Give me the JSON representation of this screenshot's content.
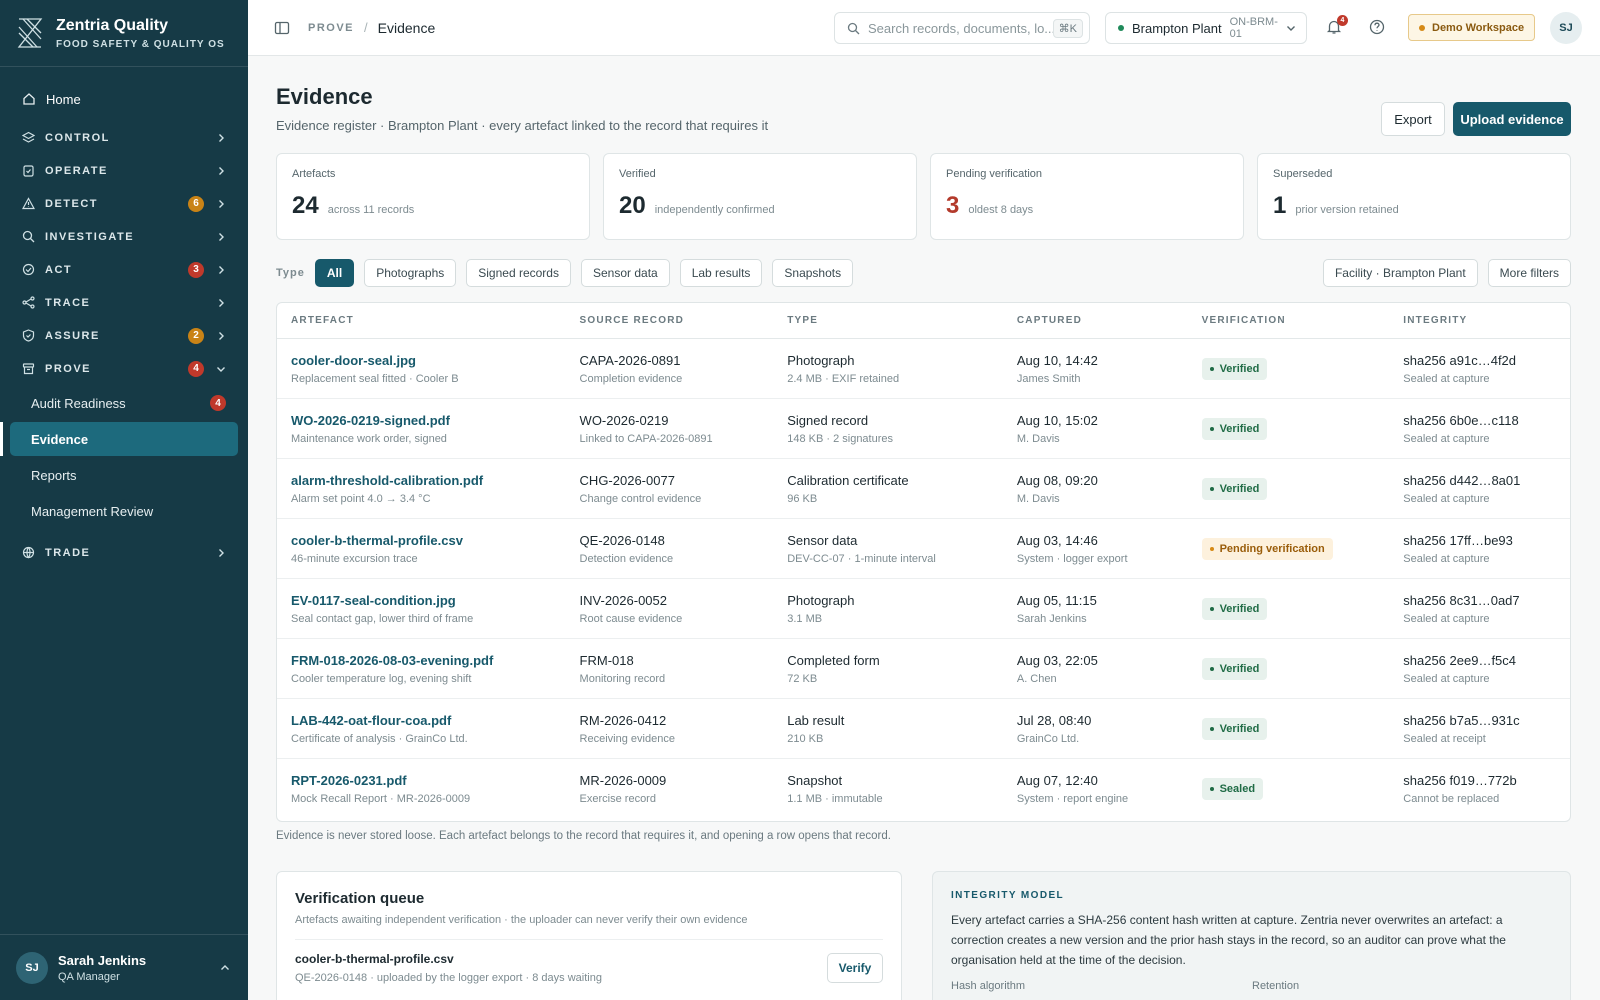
{
  "brand": {
    "title": "Zentria Quality",
    "subtitle": "FOOD SAFETY & QUALITY OS"
  },
  "nav": {
    "home": "Home",
    "sections": [
      {
        "label": "CONTROL",
        "icon": "layers-icon",
        "badge": ""
      },
      {
        "label": "OPERATE",
        "icon": "clipboard-icon",
        "badge": ""
      },
      {
        "label": "DETECT",
        "icon": "warning-icon",
        "badge": "6",
        "badge_color": "#c98316"
      },
      {
        "label": "INVESTIGATE",
        "icon": "search-icon",
        "badge": ""
      },
      {
        "label": "ACT",
        "icon": "check-circle-icon",
        "badge": "3",
        "badge_color": "#c0392b"
      },
      {
        "label": "TRACE",
        "icon": "share-icon",
        "badge": ""
      },
      {
        "label": "ASSURE",
        "icon": "shield-icon",
        "badge": "2",
        "badge_color": "#c98316"
      },
      {
        "label": "PROVE",
        "icon": "archive-icon",
        "badge": "4",
        "badge_color": "#c0392b"
      },
      {
        "label": "TRADE",
        "icon": "globe-icon",
        "badge": ""
      }
    ],
    "prove_items": [
      {
        "label": "Audit Readiness",
        "badge": "4"
      },
      {
        "label": "Evidence",
        "badge": ""
      },
      {
        "label": "Reports",
        "badge": ""
      },
      {
        "label": "Management Review",
        "badge": ""
      }
    ]
  },
  "user": {
    "initials": "SJ",
    "name": "Sarah Jenkins",
    "role": "QA Manager"
  },
  "topbar": {
    "breadcrumb_root": "PROVE",
    "breadcrumb_sep": "/",
    "breadcrumb_current": "Evidence",
    "search_placeholder": "Search records, documents, lo...",
    "search_shortcut": "⌘K",
    "plant_name": "Brampton Plant",
    "plant_code": "ON-BRM-01",
    "notification_count": "4",
    "workspace_label": "Demo Workspace",
    "avatar_initials": "SJ"
  },
  "page": {
    "title": "Evidence",
    "subtitle": "Evidence register · Brampton Plant · every artefact linked to the record that requires it",
    "export_label": "Export",
    "upload_label": "Upload evidence"
  },
  "stats": [
    {
      "label": "Artefacts",
      "value": "24",
      "note": "across 11 records"
    },
    {
      "label": "Verified",
      "value": "20",
      "note": "independently confirmed"
    },
    {
      "label": "Pending verification",
      "value": "3",
      "note": "oldest 8 days"
    },
    {
      "label": "Superseded",
      "value": "1",
      "note": "prior version retained"
    }
  ],
  "filters": {
    "label": "Type",
    "chips": [
      "All",
      "Photographs",
      "Signed records",
      "Sensor data",
      "Lab results",
      "Snapshots"
    ],
    "facility": "Facility · Brampton Plant",
    "more": "More filters"
  },
  "table": {
    "headers": [
      "ARTEFACT",
      "SOURCE RECORD",
      "TYPE",
      "CAPTURED",
      "VERIFICATION",
      "INTEGRITY"
    ],
    "rows": [
      {
        "name": "cooler-door-seal.jpg",
        "desc": "Replacement seal fitted · Cooler B",
        "record": "CAPA-2026-0891",
        "record_note": "Completion evidence",
        "type": "Photograph",
        "type_note": "2.4 MB · EXIF retained",
        "captured": "Aug 10, 14:42",
        "captured_by": "James Smith",
        "status": "Verified",
        "status_kind": "verified",
        "hash": "sha256 a91c…4f2d",
        "hash_note": "Sealed at capture"
      },
      {
        "name": "WO-2026-0219-signed.pdf",
        "desc": "Maintenance work order, signed",
        "record": "WO-2026-0219",
        "record_note": "Linked to CAPA-2026-0891",
        "type": "Signed record",
        "type_note": "148 KB · 2 signatures",
        "captured": "Aug 10, 15:02",
        "captured_by": "M. Davis",
        "status": "Verified",
        "status_kind": "verified",
        "hash": "sha256 6b0e…c118",
        "hash_note": "Sealed at capture"
      },
      {
        "name": "alarm-threshold-calibration.pdf",
        "desc": "Alarm set point 4.0 → 3.4 °C",
        "record": "CHG-2026-0077",
        "record_note": "Change control evidence",
        "type": "Calibration certificate",
        "type_note": "96 KB",
        "captured": "Aug 08, 09:20",
        "captured_by": "M. Davis",
        "status": "Verified",
        "status_kind": "verified",
        "hash": "sha256 d442…8a01",
        "hash_note": "Sealed at capture"
      },
      {
        "name": "cooler-b-thermal-profile.csv",
        "desc": "46-minute excursion trace",
        "record": "QE-2026-0148",
        "record_note": "Detection evidence",
        "type": "Sensor data",
        "type_note": "DEV-CC-07 · 1-minute interval",
        "captured": "Aug 03, 14:46",
        "captured_by": "System · logger export",
        "status": "Pending verification",
        "status_kind": "pending",
        "hash": "sha256 17ff…be93",
        "hash_note": "Sealed at capture"
      },
      {
        "name": "EV-0117-seal-condition.jpg",
        "desc": "Seal contact gap, lower third of frame",
        "record": "INV-2026-0052",
        "record_note": "Root cause evidence",
        "type": "Photograph",
        "type_note": "3.1 MB",
        "captured": "Aug 05, 11:15",
        "captured_by": "Sarah Jenkins",
        "status": "Verified",
        "status_kind": "verified",
        "hash": "sha256 8c31…0ad7",
        "hash_note": "Sealed at capture"
      },
      {
        "name": "FRM-018-2026-08-03-evening.pdf",
        "desc": "Cooler temperature log, evening shift",
        "record": "FRM-018",
        "record_note": "Monitoring record",
        "type": "Completed form",
        "type_note": "72 KB",
        "captured": "Aug 03, 22:05",
        "captured_by": "A. Chen",
        "status": "Verified",
        "status_kind": "verified",
        "hash": "sha256 2ee9…f5c4",
        "hash_note": "Sealed at capture"
      },
      {
        "name": "LAB-442-oat-flour-coa.pdf",
        "desc": "Certificate of analysis · GrainCo Ltd.",
        "record": "RM-2026-0412",
        "record_note": "Receiving evidence",
        "type": "Lab result",
        "type_note": "210 KB",
        "captured": "Jul 28, 08:40",
        "captured_by": "GrainCo Ltd.",
        "status": "Verified",
        "status_kind": "verified",
        "hash": "sha256 b7a5…931c",
        "hash_note": "Sealed at receipt"
      },
      {
        "name": "RPT-2026-0231.pdf",
        "desc": "Mock Recall Report · MR-2026-0009",
        "record": "MR-2026-0009",
        "record_note": "Exercise record",
        "type": "Snapshot",
        "type_note": "1.1 MB · immutable",
        "captured": "Aug 07, 12:40",
        "captured_by": "System · report engine",
        "status": "Sealed",
        "status_kind": "sealed",
        "hash": "sha256 f019…772b",
        "hash_note": "Cannot be replaced"
      }
    ]
  },
  "footnote": "Evidence is never stored loose. Each artefact belongs to the record that requires it, and opening a row opens that record.",
  "queue": {
    "title": "Verification queue",
    "subtitle": "Artefacts awaiting independent verification · the uploader can never verify their own evidence",
    "item_name": "cooler-b-thermal-profile.csv",
    "item_meta": "QE-2026-0148 · uploaded by the logger export · 8 days waiting",
    "verify_label": "Verify"
  },
  "integrity": {
    "title": "INTEGRITY MODEL",
    "body": "Every artefact carries a SHA-256 content hash written at capture. Zentria never overwrites an artefact: a correction creates a new version and the prior hash stays in the record, so an auditor can prove what the organisation held at the time of the decision.",
    "meta_left": "Hash algorithm",
    "meta_right": "Retention"
  },
  "colors": {
    "sidebar": "#163a46",
    "accent": "#17596b",
    "verified": "#1f6b45",
    "pending": "#d58a17",
    "alert": "#c0392b"
  }
}
